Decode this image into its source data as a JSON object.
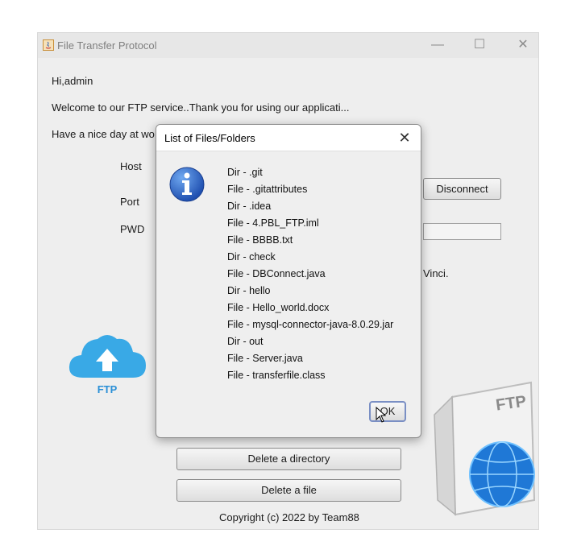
{
  "window": {
    "title": "File Transfer Protocol",
    "minimize_glyph": "—",
    "maximize_glyph": "☐",
    "close_glyph": "✕"
  },
  "main": {
    "greeting": "Hi,admin",
    "welcome": "Welcome to our FTP service..Thank you for using our applicati...",
    "nice_day": "Have a nice day at wo",
    "host_label": "Host",
    "port_label": "Port",
    "pwd_label": "PWD",
    "disconnect_label": "Disconnect",
    "partial_vinci": "Vinci.",
    "delete_dir_label": "Delete a directory",
    "delete_file_label": "Delete a file",
    "copyright": "Copyright (c) 2022 by Team88",
    "ftp_logo_text": "FTP",
    "ftp_doc_text": "FTP"
  },
  "dialog": {
    "title": "List of Files/Folders",
    "close_glyph": "✕",
    "icon": "info-icon",
    "items": [
      "Dir -  .git",
      "File - .gitattributes",
      "Dir -  .idea",
      "File - 4.PBL_FTP.iml",
      "File - BBBB.txt",
      "Dir -  check",
      "File - DBConnect.java",
      "Dir -  hello",
      "File - Hello_world.docx",
      "File - mysql-connector-java-8.0.29.jar",
      "Dir -  out",
      "File - Server.java",
      "File - transferfile.class"
    ],
    "ok_label": "OK"
  },
  "colors": {
    "cloud": "#39a9e6",
    "ftp_logo_text": "#2a8fd6",
    "info_icon": "#2f6fd0",
    "globe": "#1f78d6"
  }
}
